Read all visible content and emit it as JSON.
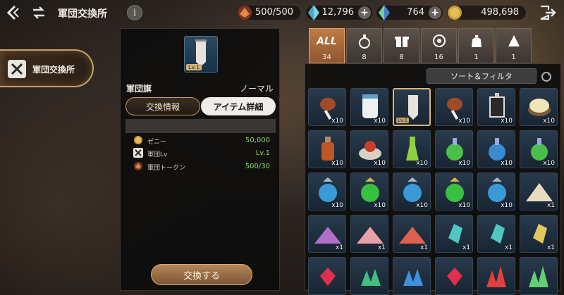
{
  "header": {
    "title": "軍団交換所",
    "info_label": "i",
    "resources": [
      {
        "name": "軍団トークン",
        "value": "500/500",
        "icon": "token-icon"
      },
      {
        "name": "クリスタル",
        "value": "12,796",
        "icon": "crystal-icon"
      },
      {
        "name": "ブルークリスタル",
        "value": "764",
        "icon": "blue-crystal-icon"
      },
      {
        "name": "ゼニー",
        "value": "498,698",
        "icon": "gold-coin-icon"
      }
    ]
  },
  "sidebar": {
    "tab_label": "軍団交換所"
  },
  "detail": {
    "thumb_level": "Lv.1",
    "name": "軍団旗",
    "rarity": "ノーマル",
    "tabs": [
      "交換情報",
      "アイテム詳細"
    ],
    "costs": [
      {
        "label": "ゼニー",
        "value": "50,000"
      },
      {
        "label": "軍団Lv",
        "value": "Lv.1"
      },
      {
        "label": "軍団トークン",
        "value": "500/30"
      }
    ],
    "exchange_label": "交換する"
  },
  "categories": [
    {
      "label": "ALL",
      "count": "34",
      "icon": "all-label"
    },
    {
      "label": "",
      "count": "8",
      "icon": "potion-icon"
    },
    {
      "label": "",
      "count": "8",
      "icon": "gift-icon"
    },
    {
      "label": "",
      "count": "16",
      "icon": "target-icon"
    },
    {
      "label": "",
      "count": "1",
      "icon": "bag-icon"
    },
    {
      "label": "",
      "count": "1",
      "icon": "cloak-icon"
    }
  ],
  "grid": {
    "sort_label": "ソート＆フィルタ",
    "items": [
      {
        "qty": "x10",
        "kind": "meat"
      },
      {
        "qty": "x10",
        "kind": "jar"
      },
      {
        "qty": "",
        "kind": "banner",
        "level": "Lv.1",
        "selected": true
      },
      {
        "qty": "x10",
        "kind": "meat"
      },
      {
        "qty": "x10",
        "kind": "press"
      },
      {
        "qty": "x10",
        "kind": "rice"
      },
      {
        "qty": "x10",
        "kind": "red-potion"
      },
      {
        "qty": "x10",
        "kind": "bowl"
      },
      {
        "qty": "x10",
        "kind": "green-vial"
      },
      {
        "qty": "x10",
        "kind": "green-flask"
      },
      {
        "qty": "x10",
        "kind": "blue-flask"
      },
      {
        "qty": "x10",
        "kind": "green-flask"
      },
      {
        "qty": "x10",
        "kind": "blue-orb"
      },
      {
        "qty": "x10",
        "kind": "green-orb"
      },
      {
        "qty": "x10",
        "kind": "blue-orb"
      },
      {
        "qty": "x10",
        "kind": "green-orb"
      },
      {
        "qty": "x10",
        "kind": "blue-orb"
      },
      {
        "qty": "x1",
        "kind": "sand-pile"
      },
      {
        "qty": "x1",
        "kind": "purple-pile"
      },
      {
        "qty": "x1",
        "kind": "pink-pile"
      },
      {
        "qty": "x1",
        "kind": "red-pile"
      },
      {
        "qty": "x1",
        "kind": "teal-crystal"
      },
      {
        "qty": "x1",
        "kind": "teal-crystal"
      },
      {
        "qty": "x1",
        "kind": "gold-crystal"
      },
      {
        "qty": "",
        "kind": "ruby"
      },
      {
        "qty": "",
        "kind": "green-shard"
      },
      {
        "qty": "",
        "kind": "blue-shard"
      },
      {
        "qty": "",
        "kind": "ruby"
      },
      {
        "qty": "",
        "kind": "red-cluster"
      },
      {
        "qty": "",
        "kind": "green-cluster"
      }
    ]
  },
  "colors": {
    "accent_gold": "#c6a067",
    "cost_green": "#8fd46a",
    "tab_orange": "#c07b45"
  }
}
